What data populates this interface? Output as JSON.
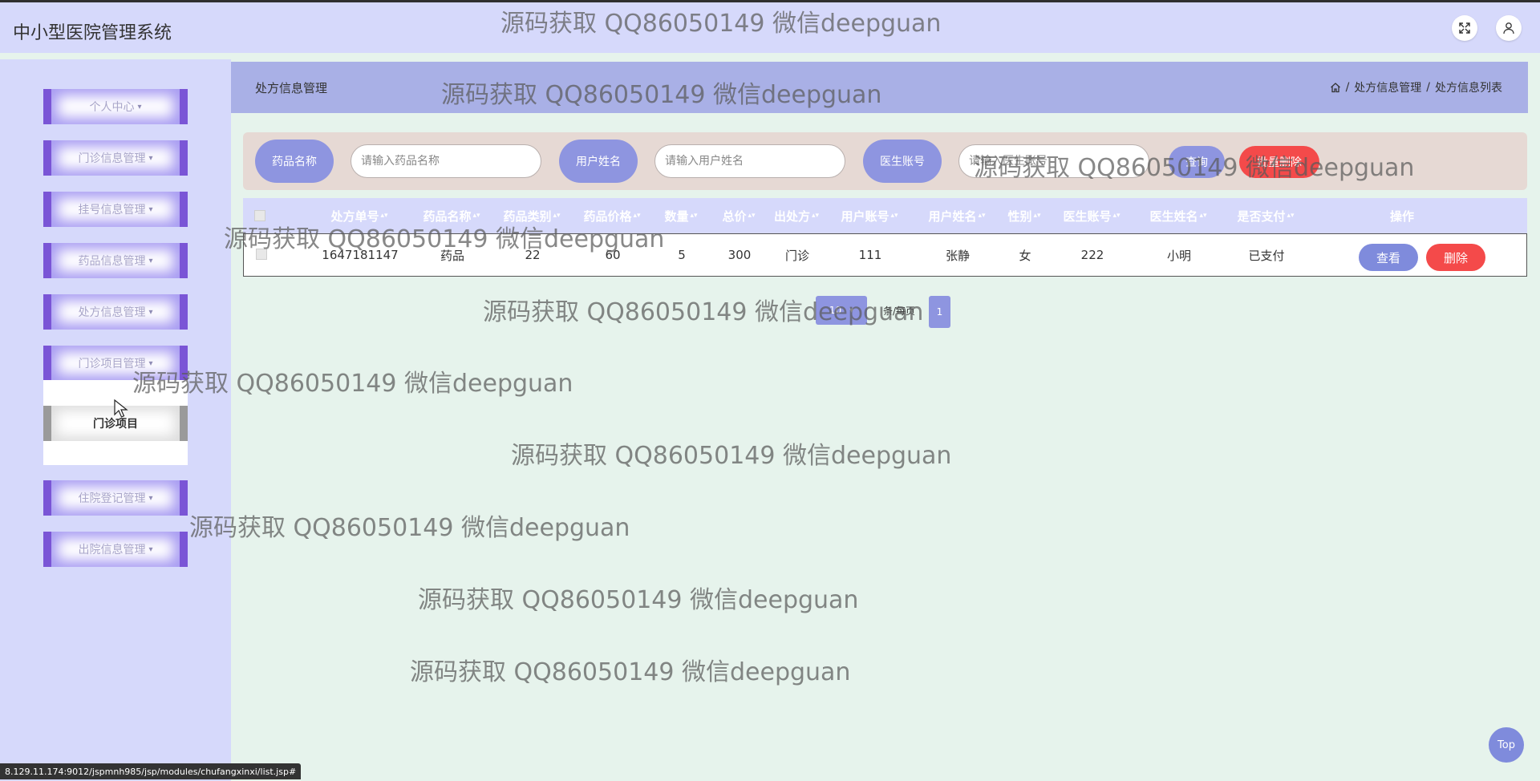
{
  "app": {
    "title": "中小型医院管理系统"
  },
  "sidebar": {
    "items": [
      {
        "label": "个人中心"
      },
      {
        "label": "门诊信息管理"
      },
      {
        "label": "挂号信息管理"
      },
      {
        "label": "药品信息管理"
      },
      {
        "label": "处方信息管理"
      },
      {
        "label": "门诊项目管理"
      },
      {
        "label": "住院登记管理"
      },
      {
        "label": "出院信息管理"
      }
    ],
    "submenu": {
      "label": "门诊项目"
    }
  },
  "main": {
    "title": "处方信息管理",
    "breadcrumb": [
      "处方信息管理",
      "处方信息列表"
    ],
    "breadcrumb_sep": "/"
  },
  "search": {
    "fields": [
      {
        "label": "药品名称",
        "placeholder": "请输入药品名称"
      },
      {
        "label": "用户姓名",
        "placeholder": "请输入用户姓名"
      },
      {
        "label": "医生账号",
        "placeholder": "请输入医生账号"
      }
    ],
    "query_label": "查询",
    "delete_label": "批量删除"
  },
  "table": {
    "columns": [
      "处方单号",
      "药品名称",
      "药品类别",
      "药品价格",
      "数量",
      "总价",
      "出处方",
      "用户账号",
      "用户姓名",
      "性别",
      "医生账号",
      "医生姓名",
      "是否支付",
      "操作"
    ],
    "rows": [
      {
        "cells": [
          "1647181147",
          "药品",
          "22",
          "60",
          "5",
          "300",
          "门诊",
          "111",
          "张静",
          "女",
          "222",
          "小明",
          "已支付"
        ],
        "view_label": "查看",
        "delete_label": "删除"
      }
    ]
  },
  "pagination": {
    "page_size": "10",
    "page_size_label": "条/每页",
    "current_page": "1"
  },
  "top_button": "Top",
  "status_url": "8.129.11.174:9012/jspmnh985/jsp/modules/chufangxinxi/list.jsp#",
  "watermark": "源码获取 QQ86050149 微信deepguan",
  "colors": {
    "header_bg": "#d6d9fb",
    "accent": "#8e95e0",
    "danger": "#f44a4a",
    "menu_border": "#7a55d6"
  }
}
